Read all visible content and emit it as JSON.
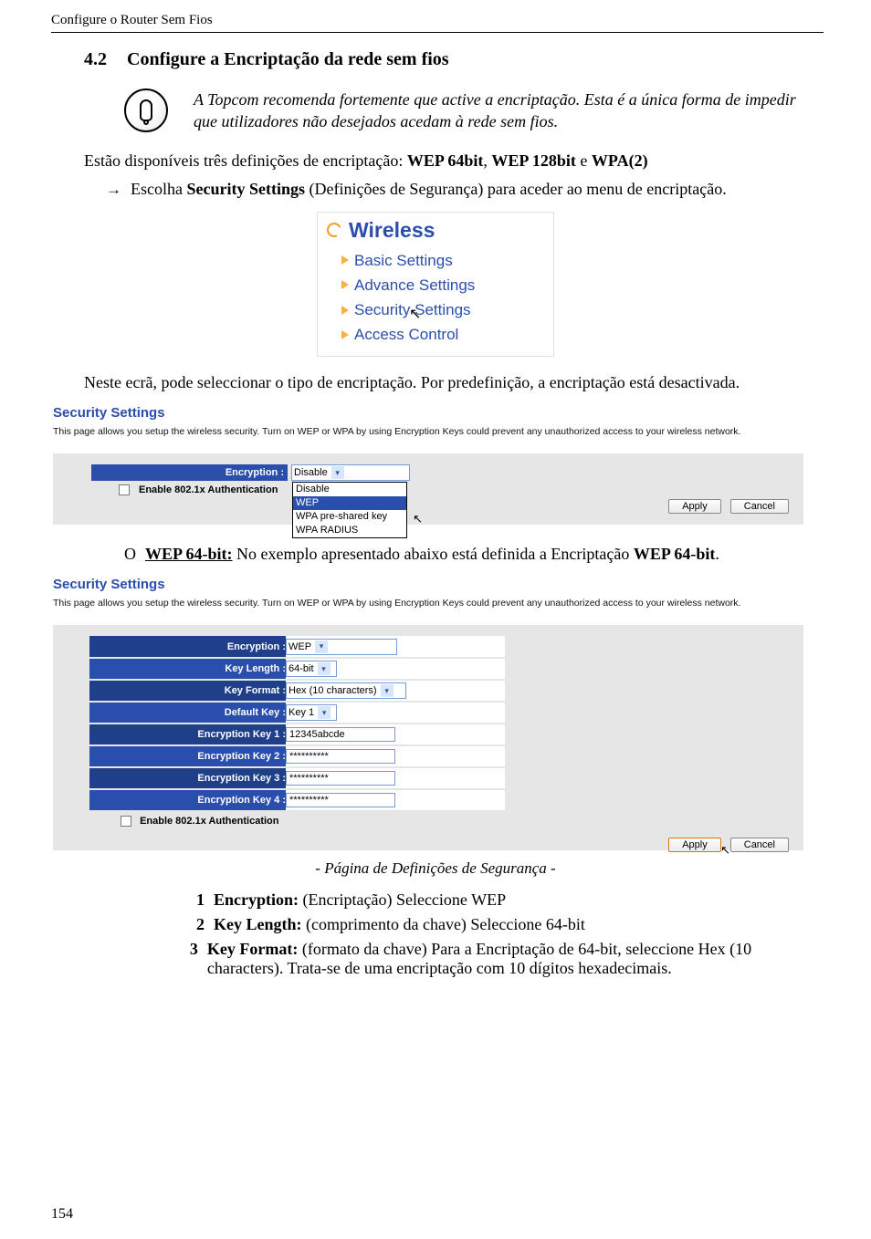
{
  "topbar": "Configure o Router Sem Fios",
  "section_num": "4.2",
  "section_title": "Configure a Encriptação da rede sem fios",
  "info": "A Topcom recomenda fortemente que active a encriptação. Esta é a única forma de impedir que utilizadores não desejados acedam à rede sem fios.",
  "para_pre": "Estão disponíveis três definições de encriptação: ",
  "enc_wep64": "WEP 64bit",
  "para_sep1": ", ",
  "enc_wep128": "WEP 128bit",
  "para_sep2": " e ",
  "enc_wpa": "WPA(2)",
  "arrow_pre": "Escolha ",
  "arrow_bold": "Security Settings",
  "arrow_post": " (Definições de Segurança) para aceder ao menu de encriptação.",
  "wireless": {
    "title": "Wireless",
    "items": [
      "Basic Settings",
      "Advance Settings",
      "Security Settings",
      "Access Control"
    ]
  },
  "para2": "Neste ecrã, pode seleccionar o tipo de encriptação. Por predefinição, a encriptação está desactivada.",
  "panel1": {
    "title": "Security Settings",
    "desc": "This page allows you setup the wireless security. Turn on WEP or WPA by using Encryption Keys could prevent any unauthorized access to your wireless network.",
    "encryption_label": "Encryption :",
    "encryption_value": "Disable",
    "auth_label": "Enable 802.1x Authentication",
    "dropdown": [
      "Disable",
      "WEP",
      "WPA pre-shared key",
      "WPA RADIUS"
    ],
    "apply": "Apply",
    "cancel": "Cancel"
  },
  "wep_pre": "WEP 64-bit:",
  "wep_mid": " No exemplo apresentado abaixo está definida a Encriptação ",
  "wep_bold": "WEP 64-bit",
  "panel2": {
    "title": "Security Settings",
    "desc": "This page allows you setup the wireless security. Turn on WEP or WPA by using Encryption Keys could prevent any unauthorized access to your wireless network.",
    "rows": {
      "encryption": {
        "label": "Encryption :",
        "value": "WEP"
      },
      "keylen": {
        "label": "Key Length :",
        "value": "64-bit"
      },
      "keyfmt": {
        "label": "Key Format :",
        "value": "Hex (10 characters)"
      },
      "defkey": {
        "label": "Default Key :",
        "value": "Key 1"
      },
      "k1": {
        "label": "Encryption Key 1 :",
        "value": "12345abcde"
      },
      "k2": {
        "label": "Encryption Key 2 :",
        "value": "**********"
      },
      "k3": {
        "label": "Encryption Key 3 :",
        "value": "**********"
      },
      "k4": {
        "label": "Encryption Key 4 :",
        "value": "**********"
      }
    },
    "auth_label": "Enable 802.1x Authentication",
    "apply": "Apply",
    "cancel": "Cancel"
  },
  "caption": "- Página de Definições de Segurança -",
  "steps": [
    {
      "n": "1",
      "b": "Encryption:",
      "t": " (Encriptação) Seleccione WEP"
    },
    {
      "n": "2",
      "b": "Key Length:",
      "t": " (comprimento da chave) Seleccione 64-bit"
    },
    {
      "n": "3",
      "b": "Key Format:",
      "t": " (formato da chave) Para a Encriptação de 64-bit, seleccione Hex (10 characters). Trata-se de uma encriptação com 10 dígitos hexadecimais."
    }
  ],
  "page_number": "154"
}
